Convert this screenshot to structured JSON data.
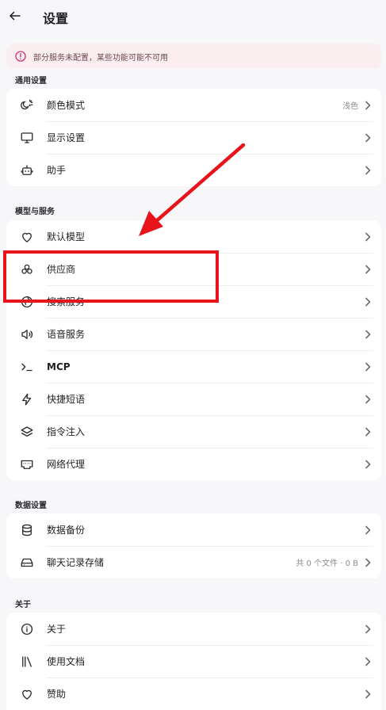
{
  "header": {
    "title": "设置"
  },
  "banner": {
    "text": "部分服务未配置，某些功能可能不可用"
  },
  "sections": {
    "general": {
      "label": "通用设置",
      "items": [
        {
          "label": "颜色模式",
          "value": "浅色"
        },
        {
          "label": "显示设置"
        },
        {
          "label": "助手"
        }
      ]
    },
    "models": {
      "label": "模型与服务",
      "items": [
        {
          "label": "默认模型"
        },
        {
          "label": "供应商"
        },
        {
          "label": "搜索服务"
        },
        {
          "label": "语音服务"
        },
        {
          "label": "MCP"
        },
        {
          "label": "快捷短语"
        },
        {
          "label": "指令注入"
        },
        {
          "label": "网络代理"
        }
      ]
    },
    "data": {
      "label": "数据设置",
      "items": [
        {
          "label": "数据备份"
        },
        {
          "label": "聊天记录存储",
          "value": "共 0 个文件 · 0 B"
        }
      ]
    },
    "about": {
      "label": "关于",
      "items": [
        {
          "label": "关于"
        },
        {
          "label": "使用文档"
        },
        {
          "label": "赞助"
        }
      ]
    }
  },
  "colors": {
    "annotation": "#e8141b",
    "banner_bg": "#fbeef1",
    "banner_icon": "#d6336c"
  }
}
